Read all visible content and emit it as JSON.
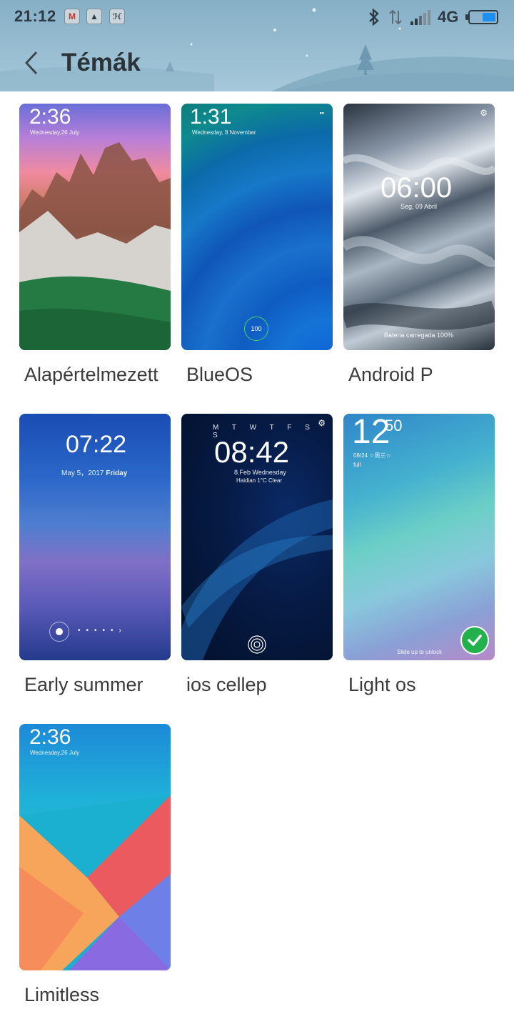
{
  "status_bar": {
    "time": "21:12",
    "network": "4G",
    "icons": [
      "gmail-icon",
      "app-icon",
      "app-icon-2",
      "bluetooth-icon",
      "data-arrows-icon",
      "signal-icon",
      "battery-icon"
    ],
    "notif_glyphs": [
      "M",
      "▲",
      "ℋ"
    ]
  },
  "header": {
    "title": "Témák",
    "back_icon": "chevron-left-icon"
  },
  "themes": [
    {
      "label": "Alapértelmezett",
      "time": "2:36",
      "sub": "Wednesday,26 July"
    },
    {
      "label": "BlueOS",
      "time": "1:31",
      "sub": "Wednesday, 8 November",
      "badge": "100"
    },
    {
      "label": "Android P",
      "time": "06:00",
      "sub": "Seg, 09 Abril",
      "footer": "Bateria carregada 100%"
    },
    {
      "label": "Early summer",
      "time": "07:22",
      "sub": "May 5，2017",
      "sub_bold": "Friday"
    },
    {
      "label": "ios cellep",
      "time": "08:42",
      "days": "M T W T F S S",
      "sub": "8.Feb Wednesday",
      "sub2": "Haidian 1°C Clear"
    },
    {
      "label": "Light os",
      "time": "12",
      "time_small": "50",
      "sub": "08/24 ☆周三☆",
      "sub2": "full",
      "footer": "Slide up to unlock",
      "selected": true
    },
    {
      "label": "Limitless",
      "time": "2:36",
      "sub": "Wednesday,26 July"
    }
  ],
  "colors": {
    "header_bg": "#98bdd1",
    "selected_check": "#22b14c",
    "battery_fill": "#1e8ef0"
  }
}
